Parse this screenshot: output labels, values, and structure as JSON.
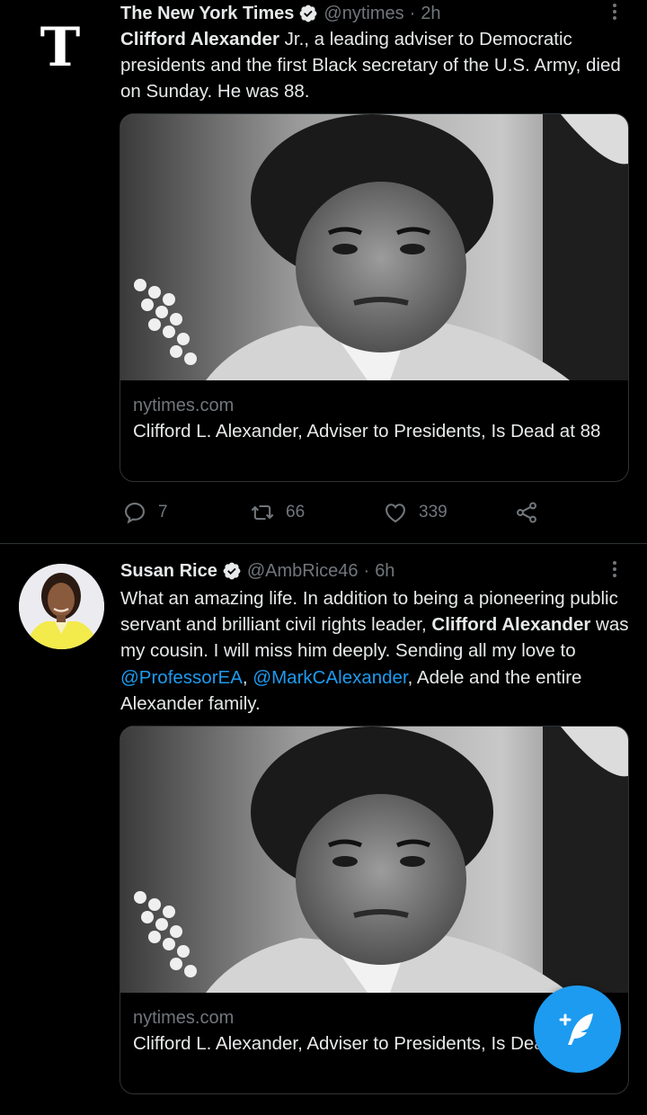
{
  "tweets": [
    {
      "author_name": "The New York Times",
      "handle": "@nytimes",
      "separator": "·",
      "time": "2h",
      "text_bold": "Clifford Alexander",
      "text_rest": " Jr., a leading adviser to Democratic presidents and the first Black secretary of the U.S. Army, died on Sunday. He was 88.",
      "card": {
        "domain": "nytimes.com",
        "title": "Clifford L. Alexander, Adviser to Presidents, Is Dead at 88"
      },
      "replies": "7",
      "retweets": "66",
      "likes": "339"
    },
    {
      "author_name": "Susan Rice",
      "handle": "@AmbRice46",
      "separator": "·",
      "time": "6h",
      "text_part1": "What an amazing life. In addition to being a pioneering public servant and brilliant civil rights leader, ",
      "text_bold": "Clifford Alexander",
      "text_part2": " was my cousin. I will miss him deeply. Sending all my love to ",
      "mention1": "@ProfessorEA",
      "comma": ", ",
      "mention2": "@MarkCAlexander",
      "text_part3": ", Adele and the entire Alexander family.",
      "card": {
        "domain": "nytimes.com",
        "title": "Clifford L. Alexander, Adviser to Presidents, Is Dead at 88"
      }
    }
  ],
  "avatars": {
    "nyt_glyph": "T"
  },
  "icons": {
    "verified": "verified-badge-icon",
    "reply": "reply-icon",
    "retweet": "retweet-icon",
    "like": "heart-icon",
    "share": "share-icon",
    "compose": "compose-tweet-icon",
    "more": "more-options-icon"
  },
  "colors": {
    "accent": "#1d9bf0",
    "background": "#000000",
    "muted": "#71767b"
  }
}
